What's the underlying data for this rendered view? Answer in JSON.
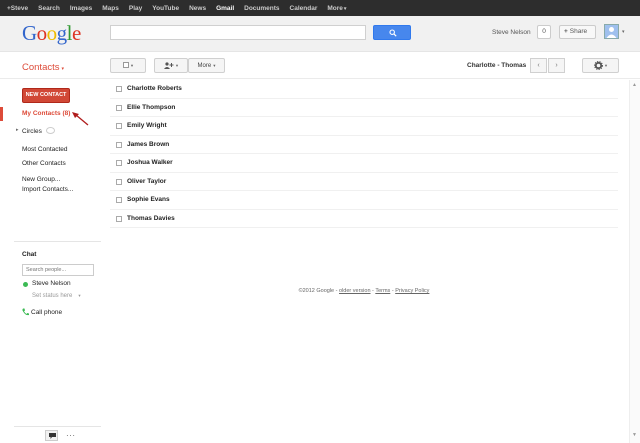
{
  "topbar": {
    "items": [
      {
        "label": "+Steve",
        "active": false
      },
      {
        "label": "Search",
        "active": false
      },
      {
        "label": "Images",
        "active": false
      },
      {
        "label": "Maps",
        "active": false
      },
      {
        "label": "Play",
        "active": false
      },
      {
        "label": "YouTube",
        "active": false
      },
      {
        "label": "News",
        "active": false
      },
      {
        "label": "Gmail",
        "active": true
      },
      {
        "label": "Documents",
        "active": false
      },
      {
        "label": "Calendar",
        "active": false
      },
      {
        "label": "More",
        "active": false
      }
    ],
    "more_caret": "▾"
  },
  "header": {
    "logo": {
      "l1": "G",
      "l2": "o",
      "l3": "o",
      "l4": "g",
      "l5": "l",
      "l6": "e"
    },
    "search_value": "",
    "user_name": "Steve Nelson",
    "notification_count": "0",
    "share_label": "Share",
    "share_plus": "+"
  },
  "toolbar": {
    "app_title": "Contacts",
    "caret": "▾",
    "more_label": "More",
    "contact_range": "Charlotte - Thomas",
    "prev": "‹",
    "next": "›"
  },
  "sidebar": {
    "new_contact_label": "NEW CONTACT",
    "my_contacts": "My Contacts (8)",
    "circles": "Circles",
    "most_contacted": "Most Contacted",
    "other_contacts": "Other Contacts",
    "new_group": "New Group...",
    "import_contacts": "Import Contacts..."
  },
  "chat": {
    "title": "Chat",
    "search_placeholder": "Search people...",
    "user_name": "Steve Nelson",
    "set_status": "Set status here",
    "call_phone": "Call phone",
    "more_dots": "···"
  },
  "contacts": [
    "Charlotte Roberts",
    "Ellie Thompson",
    "Emily Wright",
    "James Brown",
    "Joshua Walker",
    "Oliver Taylor",
    "Sophie Evans",
    "Thomas Davies"
  ],
  "footer": {
    "copyright": "©2012 Google - ",
    "older_version": "older version",
    "sep1": " - ",
    "terms": "Terms",
    "sep2": " - ",
    "privacy": "Privacy Policy"
  },
  "colors": {
    "accent_red": "#dd4b39",
    "search_blue": "#4787ed",
    "topbar_bg": "#2d2d2d",
    "online_green": "#3cba54"
  }
}
